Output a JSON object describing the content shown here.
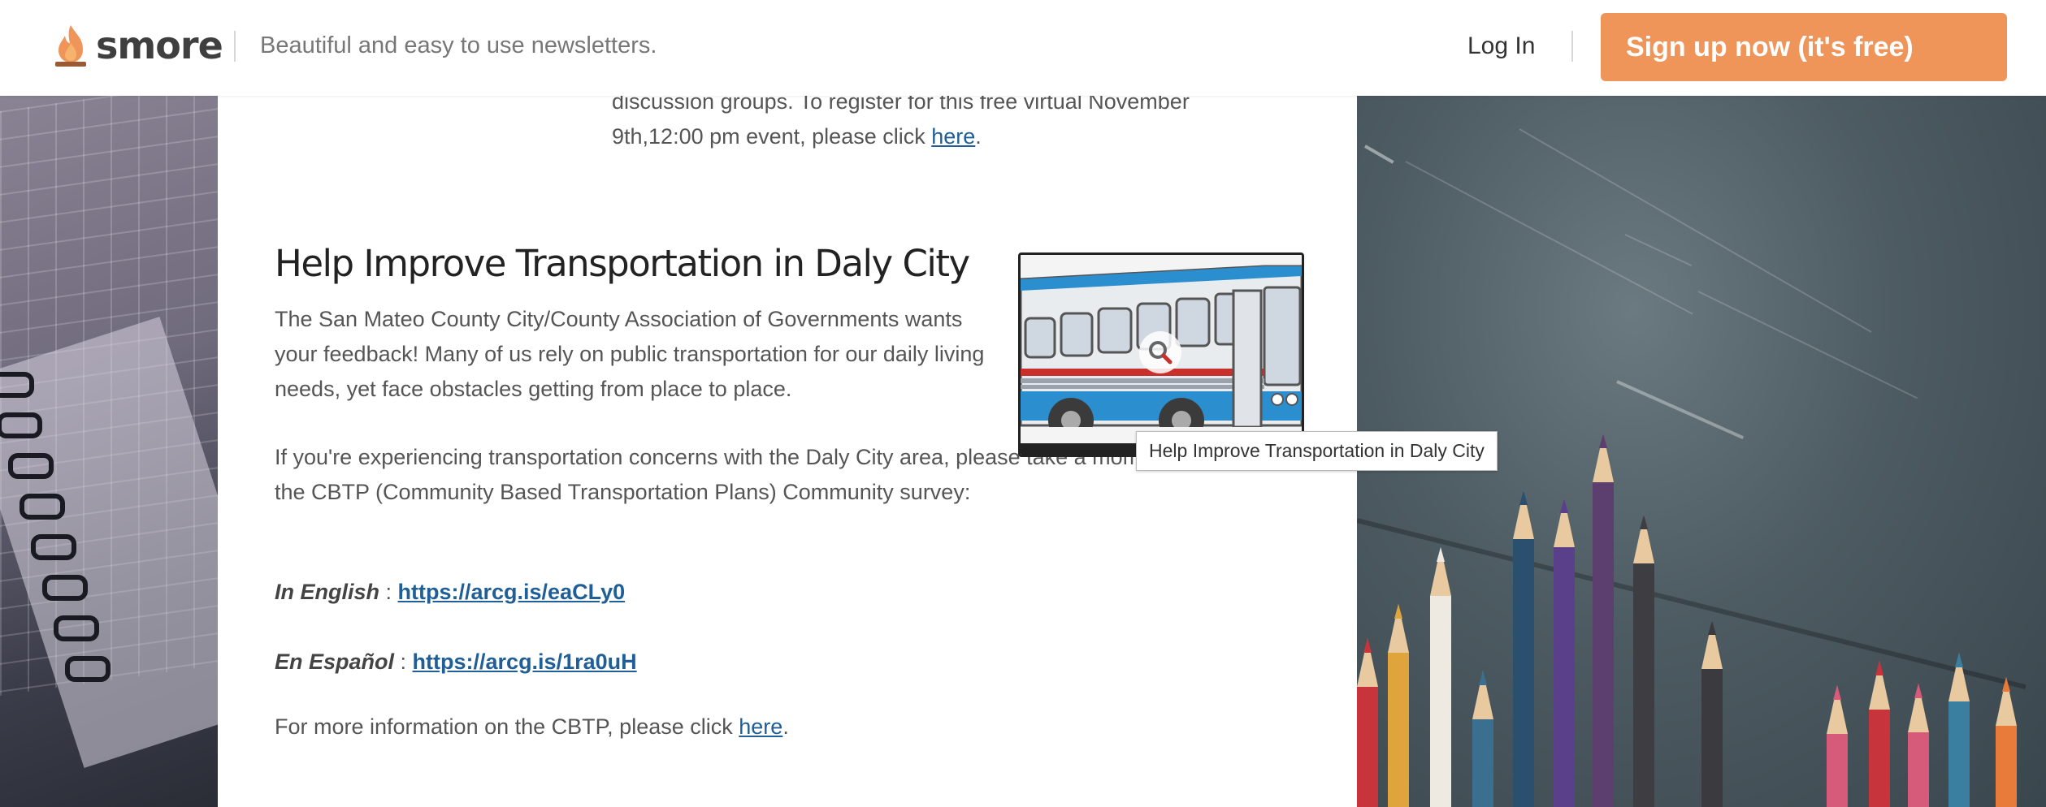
{
  "header": {
    "logo_text": "smore",
    "tagline": "Beautiful and easy to use newsletters.",
    "login_label": "Log In",
    "signup_label": "Sign up now (it's free)",
    "brand_color": "#f0955a"
  },
  "content": {
    "prev_fragment_line1": "discussion groups. To register for this free virtual November",
    "prev_fragment_line2_prefix": "9th,12:00 pm event, please click",
    "prev_fragment_link": "here",
    "section_title": "Help Improve Transportation in Daly City",
    "para1": "The San Mateo County City/County Association of Governments wants your feedback! Many of us rely on public transportation for our daily living needs, yet face obstacles getting from place to place.",
    "para2": "If you're experiencing transportation concerns with the Daly City area, please take a moment to fill out the CBTP (Community Based Transportation Plans) Community survey:",
    "english_label": "In English",
    "english_link": "https://arcg.is/eaCLy0",
    "spanish_label": "En Español",
    "spanish_link": "https://arcg.is/1ra0uH",
    "more_info_prefix": "For more information on the CBTP, please click",
    "more_info_link": "here",
    "separator": " : ",
    "period": "."
  },
  "image": {
    "tooltip": "Help Improve Transportation in Daly City",
    "icon": "zoom-icon"
  }
}
